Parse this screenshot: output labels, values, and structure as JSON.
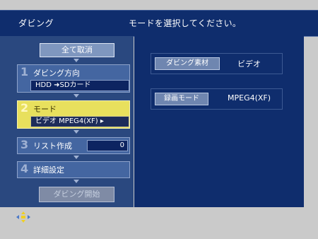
{
  "header": {
    "mode_title": "ダビング",
    "instruction": "モードを選択してください。"
  },
  "left_panel": {
    "cancel_all": "全て取消",
    "steps": [
      {
        "number": "1",
        "label": "ダビング方向",
        "value": "HDD ➜SDカード"
      },
      {
        "number": "2",
        "label": "モード",
        "value": "ビデオ MPEG4(XF) ▸",
        "active": true
      },
      {
        "number": "3",
        "label": "リスト作成",
        "value": "0"
      },
      {
        "number": "4",
        "label": "詳細設定"
      }
    ],
    "start_dubbing": "ダビング開始"
  },
  "right_panel": {
    "rows": [
      {
        "label": "ダビング素材",
        "value": "ビデオ"
      },
      {
        "label": "録画モード",
        "value": "MPEG4(XF)"
      }
    ]
  },
  "icons": {
    "nav_pad": "directional-pad-icon"
  },
  "colors": {
    "background": "#cacaca",
    "panel_dark": "#0f2d6d",
    "panel_mid": "#2a487f",
    "step_bg": "#4466a1",
    "active_step": "#e8e05d",
    "nav_pad_yellow": "#f0d020"
  }
}
